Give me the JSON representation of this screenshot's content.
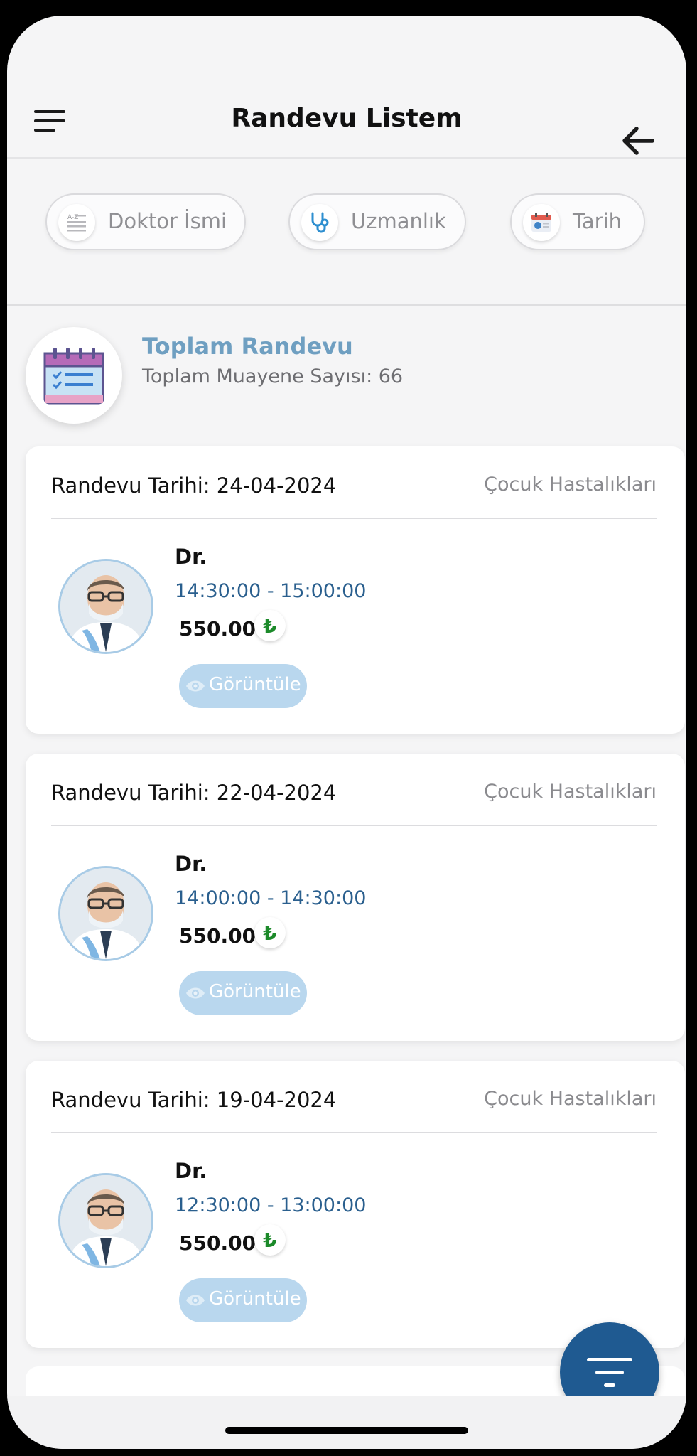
{
  "header": {
    "title": "Randevu Listem"
  },
  "filters": [
    {
      "label": "Doktor İsmi",
      "icon": "document-list-icon"
    },
    {
      "label": "Uzmanlık",
      "icon": "stethoscope-icon"
    },
    {
      "label": "Tarih",
      "icon": "calendar-clock-icon"
    }
  ],
  "summary": {
    "title": "Toplam Randevu",
    "subtitle": "Toplam Muayene Sayısı: 66",
    "icon": "calendar-checklist-icon"
  },
  "appointments": [
    {
      "date": "Randevu Tarihi: 24-04-2024",
      "specialty": "Çocuk Hastalıkları",
      "doctor": "Dr.",
      "time": "14:30:00 - 15:00:00",
      "price": "550.00",
      "currency": "₺",
      "button": "Görüntüle"
    },
    {
      "date": "Randevu Tarihi: 22-04-2024",
      "specialty": "Çocuk Hastalıkları",
      "doctor": "Dr.",
      "time": "14:00:00 - 14:30:00",
      "price": "550.00",
      "currency": "₺",
      "button": "Görüntüle"
    },
    {
      "date": "Randevu Tarihi: 19-04-2024",
      "specialty": "Çocuk Hastalıkları",
      "doctor": "Dr.",
      "time": "12:30:00 - 13:00:00",
      "price": "550.00",
      "currency": "₺",
      "button": "Görüntüle"
    }
  ],
  "colors": {
    "accent": "#1f5a91",
    "summary_title": "#6f9fc1",
    "time_text": "#2a5f8e",
    "view_button": "#b9d7ee",
    "currency_green": "#1c8a2a"
  }
}
